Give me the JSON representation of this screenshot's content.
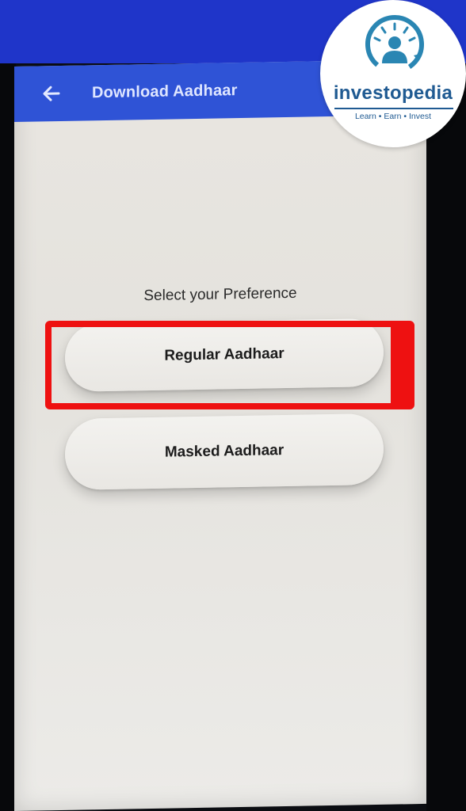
{
  "app_bar": {
    "title": "Download Aadhaar",
    "back_icon": "arrow-left-icon"
  },
  "preference": {
    "label": "Select your Preference",
    "options": [
      {
        "label": "Regular Aadhaar"
      },
      {
        "label": "Masked Aadhaar"
      }
    ]
  },
  "logo": {
    "word": "investopedia",
    "tagline": "Learn • Earn • Invest",
    "icon": "person-gauge-icon"
  },
  "colors": {
    "app_bar": "#2f53d6",
    "highlight": "#ee1111",
    "brand": "#1f5a92"
  }
}
